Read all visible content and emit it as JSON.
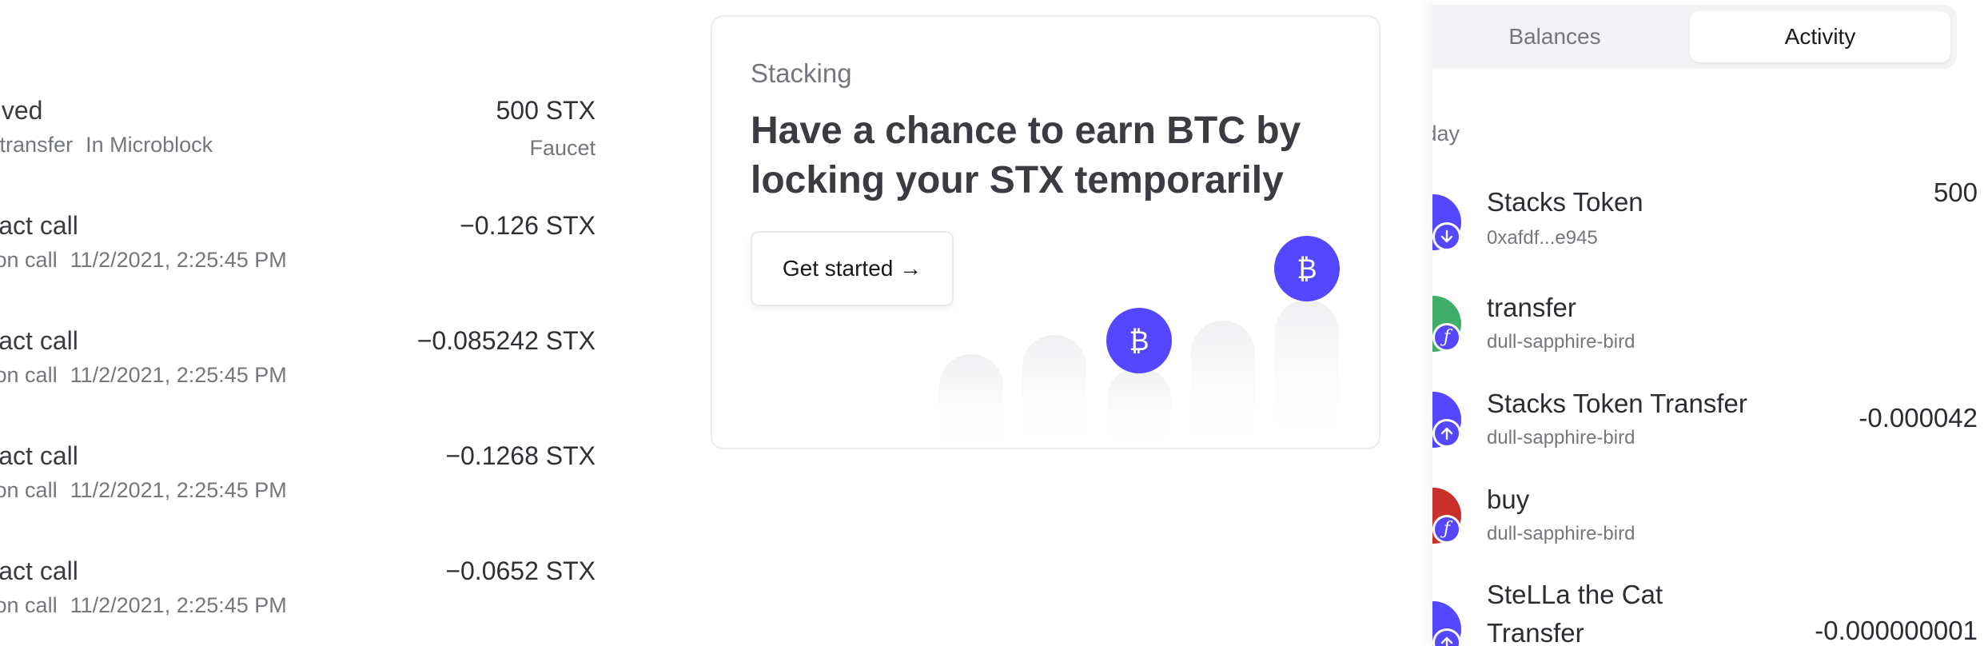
{
  "transactions": [
    {
      "title": "Received",
      "sub_type": "Token transfer",
      "sub_status": "In Microblock",
      "amount": "500 STX",
      "source": "Faucet"
    },
    {
      "title": "Contract call",
      "sub_type": "Function call",
      "sub_status": "11/2/2021, 2:25:45 PM",
      "amount": "−0.126 STX",
      "source": ""
    },
    {
      "title": "Contract call",
      "sub_type": "Function call",
      "sub_status": "11/2/2021, 2:25:45 PM",
      "amount": "−0.085242 STX",
      "source": ""
    },
    {
      "title": "Contract call",
      "sub_type": "Function call",
      "sub_status": "11/2/2021, 2:25:45 PM",
      "amount": "−0.1268 STX",
      "source": ""
    },
    {
      "title": "Contract call",
      "sub_type": "Function call",
      "sub_status": "11/2/2021, 2:25:45 PM",
      "amount": "−0.0652 STX",
      "source": ""
    }
  ],
  "stacking_card": {
    "caption": "Stacking",
    "headline": "Have a chance to earn BTC by locking your STX temporarily",
    "cta_label": "Get started →",
    "coin_symbol": "₿",
    "accent_color": "#5546ff"
  },
  "activity_panel": {
    "tabs": [
      {
        "label": "Balances",
        "active": false
      },
      {
        "label": "Activity",
        "active": true
      }
    ],
    "day_label": "Today",
    "items": [
      {
        "title": "Stacks Token",
        "subtitle": "0xafdf...e945",
        "value": "500",
        "avatar_color": "#5546ff",
        "badge_icon": "arrow-down-icon"
      },
      {
        "title": "transfer",
        "subtitle": "dull-sapphire-bird",
        "value": "",
        "avatar_color": "#3fae6a",
        "badge_icon": "function-icon"
      },
      {
        "title": "Stacks Token Transfer",
        "subtitle": "dull-sapphire-bird",
        "value": "-0.000042",
        "avatar_color": "#5546ff",
        "badge_icon": "arrow-up-icon"
      },
      {
        "title": "buy",
        "subtitle": "dull-sapphire-bird",
        "value": "",
        "avatar_color": "#c9302c",
        "badge_icon": "function-icon"
      },
      {
        "title": "SteLLa the Cat Transfer",
        "subtitle": "",
        "value": "-0.000000001",
        "avatar_color": "#5546ff",
        "badge_icon": "arrow-up-icon"
      }
    ]
  }
}
